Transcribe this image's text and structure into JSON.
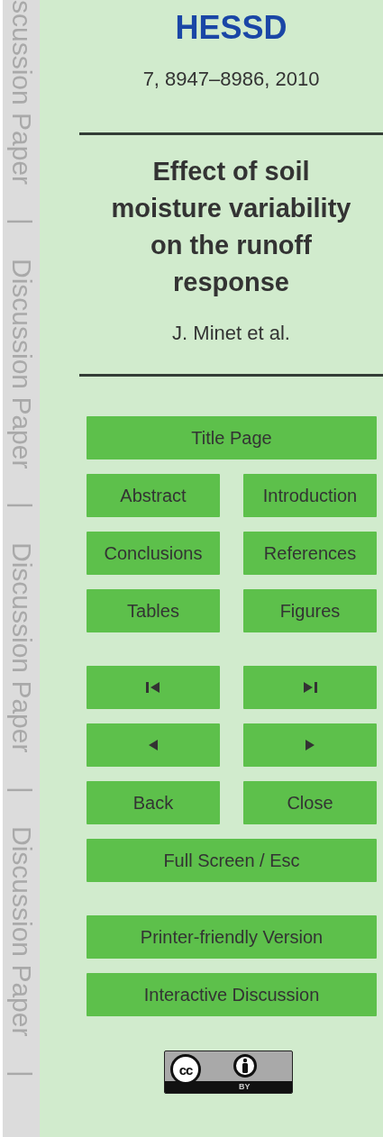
{
  "margin_strip": [
    "scussion Paper",
    "|",
    "Discussion Paper",
    "|",
    "Discussion Paper",
    "|",
    "Discussion Paper",
    "|"
  ],
  "journal": "HESSD",
  "citation": "7, 8947–8986, 2010",
  "title": "Effect of soil moisture variability on the runoff response",
  "authors": "J. Minet et al.",
  "nav_groups": [
    [
      [
        {
          "label": "Title Page"
        }
      ],
      [
        {
          "label": "Abstract"
        },
        {
          "label": "Introduction"
        }
      ],
      [
        {
          "label": "Conclusions"
        },
        {
          "label": "References"
        }
      ],
      [
        {
          "label": "Tables"
        },
        {
          "label": "Figures"
        }
      ]
    ],
    [
      [
        {
          "kind": "icon"
        },
        {
          "kind": "icon"
        }
      ],
      [
        {
          "kind": "icon"
        },
        {
          "kind": "icon"
        }
      ],
      [
        {
          "label": "Back"
        },
        {
          "label": "Close"
        }
      ],
      [
        {
          "label": "Full Screen / Esc"
        }
      ]
    ],
    [
      [
        {
          "label": "Printer-friendly Version"
        }
      ],
      [
        {
          "label": "Interactive Discussion"
        }
      ]
    ]
  ],
  "license": {
    "symbol": "cc",
    "attribution": "BY"
  }
}
